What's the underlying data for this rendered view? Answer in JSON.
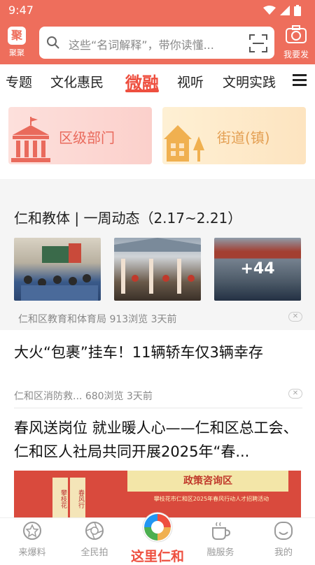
{
  "status_bar": {
    "time": "9:47"
  },
  "header": {
    "logo_glyph": "聚",
    "logo_label": "聚聚",
    "search_placeholder": "这些“名词解释”，带你读懂...",
    "camera_label": "我要发"
  },
  "tabs": [
    "专题",
    "文化惠民",
    "微融",
    "视听",
    "文明实践"
  ],
  "active_tab_index": 2,
  "quick_cards": [
    {
      "label": "区级部门",
      "icon": "government-building-icon",
      "color": "#e96a5c"
    },
    {
      "label": "街道(镇)",
      "icon": "house-tree-icon",
      "color": "#e4a054"
    }
  ],
  "articles": [
    {
      "title": "仁和教体 | 一周动态（2.17~2.21）",
      "source": "仁和区教育和体育局",
      "views": "913浏览",
      "time": "3天前",
      "more_images": "+44"
    },
    {
      "title": "大火“包裹”挂车！11辆轿车仅3辆幸存",
      "source": "仁和区消防救...",
      "views": "680浏览",
      "time": "3天前"
    },
    {
      "title": "春风送岗位 就业暖人心——仁和区总工会、仁和区人社局共同开展2025年“春...",
      "banner_heading": "政策咨询区",
      "banner_sub": "攀枝花市仁和区2025年春风行动人才招聘活动",
      "banner_left": "攀枝花",
      "banner_left2": "春风行"
    }
  ],
  "bottom_nav": [
    {
      "label": "来爆料",
      "icon": "star-badge-icon"
    },
    {
      "label": "全民拍",
      "icon": "camera-aperture-icon"
    },
    {
      "label": "这里仁和",
      "icon": "renhe-logo-icon"
    },
    {
      "label": "融服务",
      "icon": "coffee-cup-icon"
    },
    {
      "label": "我的",
      "icon": "smiley-icon"
    }
  ],
  "colors": {
    "brand": "#ee6e5c",
    "accent": "#ee4f3f"
  }
}
